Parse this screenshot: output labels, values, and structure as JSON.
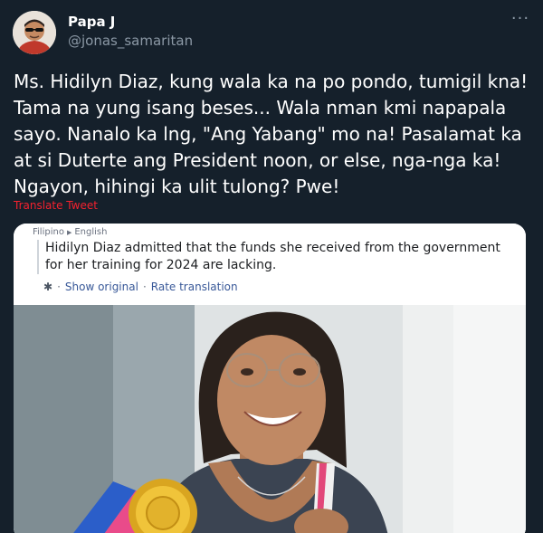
{
  "tweet": {
    "display_name": "Papa J",
    "handle": "@jonas_samaritan",
    "more_icon": "more-horizontal-icon",
    "text": "Ms. Hidilyn Diaz, kung wala ka na po pondo, tumigil kna! Tama na yung isang beses... Wala nman kmi napapala sayo. Nanalo ka lng, \"Ang Yabang\" mo na! Pasalamat ka at si Duterte ang President noon, or else, nga-nga ka! Ngayon, hihingi ka ulit tulong? Pwe!",
    "translate_label": "Translate Tweet"
  },
  "embedded": {
    "source_lang": "Filipino",
    "target_lang": "English",
    "translated_text": "Hidilyn Diaz admitted that the funds she received from the government for her training for 2024 are lacking.",
    "show_original": "Show original",
    "separator": "·",
    "rate_translation": "Rate translation",
    "gear_icon": "gear-icon"
  },
  "colors": {
    "background": "#15202b",
    "text": "#ffffff",
    "secondary_text": "#8b98a5",
    "translate_link": "#f4212e",
    "fb_link": "#385898"
  }
}
